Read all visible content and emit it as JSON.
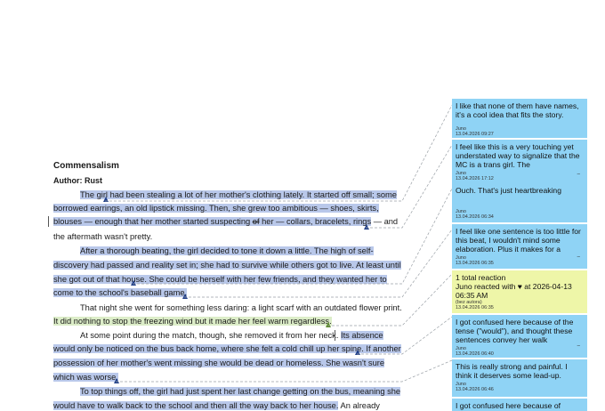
{
  "document": {
    "title": "Commensalism",
    "author": "Author: Rust",
    "lines": [
      {
        "pre": "",
        "hl": "The girl had been stealing a lot of her mother's clothing lately. It started off small; some",
        "post": ""
      },
      {
        "pre": "",
        "hl": "borrowed earrings, an old lipstick missing. Then, she grew too ambitious — shoes, skirts,",
        "post": ""
      },
      {
        "pre": "",
        "hl": "blouses — enough that her mother started suspecting ",
        "strike": "of",
        "hl2": " her — collars, bracelets, rings",
        "post": " — and"
      },
      {
        "pre": "the aftermath wasn't pretty.",
        "hl": "",
        "post": ""
      },
      {
        "pre": "",
        "hl": "After a thorough beating, the girl decided to tone it down a little. The high of self-",
        "post": ""
      },
      {
        "pre": "",
        "hl": "discovery had passed and reality set in; she had to survive while others got to live. At least until",
        "post": ""
      },
      {
        "pre": "",
        "hl": "she got out of that house. She could be herself with her few friends, and they wanted her to",
        "post": ""
      },
      {
        "pre": "",
        "hl": "come to the school's baseball game.",
        "post": ""
      },
      {
        "pre": "That night she went for something less daring: a light scarf with an outdated flower print.",
        "hl": "",
        "post": ""
      },
      {
        "pre": "",
        "hlg": "It did nothing to stop the freezing wind but it made her feel warm regardless.",
        "post": ""
      },
      {
        "pre": "At some point during the match, though, she removed it from her neck. ",
        "hl": "Its absence",
        "post": ""
      },
      {
        "pre": "",
        "hl": "would only be noticed on the bus back home, where she felt a cold chill up her spine. If another",
        "post": ""
      },
      {
        "pre": "",
        "hl": "possession of her mother's went missing she would be dead or homeless. She wasn't sure",
        "post": ""
      },
      {
        "pre": "",
        "hl": "which was worse.",
        "post": ""
      },
      {
        "pre": "",
        "hl": "To top things off, the girl had just spent her last change getting on the bus, meaning she",
        "post": ""
      },
      {
        "pre": "",
        "hl": "would have to walk back to the school and then all the way back to her house.",
        "post": " An already"
      }
    ]
  },
  "comments": [
    {
      "text": "I like that none of them have names, it's a cool idea that fits the story.",
      "author": "Juno",
      "date": "13.04.2026 09:27",
      "color": "#8fd3f5"
    },
    {
      "text": "I feel like this is a very touching yet understated way to signalize that the MC is a trans girl. The",
      "author": "Juno",
      "date": "13.04.2026 17:12",
      "more": "–",
      "color": "#8fd3f5"
    },
    {
      "text": "Ouch. That's just heartbreaking",
      "author": "Juno",
      "date": "13.04.2026 06:34",
      "color": "#8fd3f5"
    },
    {
      "text": "I feel like one sentence is too little for this beat, I wouldn't mind some elaboration. Plus it makes for a",
      "author": "Juno",
      "date": "13.04.2026 06:35",
      "more": "–",
      "color": "#8fd3f5"
    },
    {
      "text": "1 total reaction\nJuno reacted with ♥ at 2026-04-13 06:35 AM",
      "author": "",
      "date": "13.04.2026 06:35",
      "extra": "(bez autora)",
      "color": "#eef6a8"
    },
    {
      "text": "I got confused here because of the tense (\"would\"), and thought these sentences convey her walk",
      "author": "Juno",
      "date": "13.04.2026 06:40",
      "more": "–",
      "color": "#8fd3f5"
    },
    {
      "text": "This is really strong and painful. I think it deserves some lead-up.",
      "author": "Juno",
      "date": "13.04.2026 06:46",
      "color": "#8fd3f5"
    },
    {
      "text": "I got confused here because of",
      "author": "",
      "date": "",
      "color": "#8fd3f5"
    }
  ]
}
